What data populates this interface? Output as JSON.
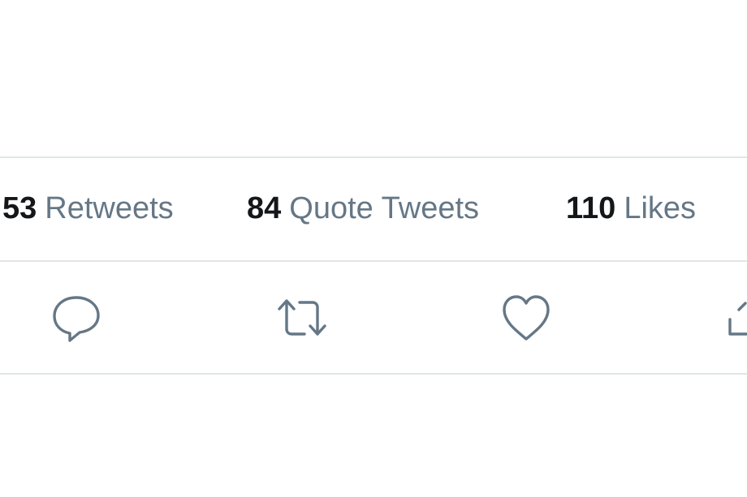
{
  "stats": {
    "retweets": {
      "count": "53",
      "label": "Retweets"
    },
    "quote_tweets": {
      "count": "84",
      "label": "Quote Tweets"
    },
    "likes": {
      "count": "110",
      "label": "Likes"
    }
  },
  "actions": {
    "icons": [
      "reply-icon",
      "retweet-icon",
      "like-icon",
      "share-icon"
    ]
  },
  "colors": {
    "count_text": "#14171a",
    "label_text": "#657786",
    "icon_stroke": "#657786",
    "divider": "#e1e5e8",
    "background": "#ffffff"
  }
}
